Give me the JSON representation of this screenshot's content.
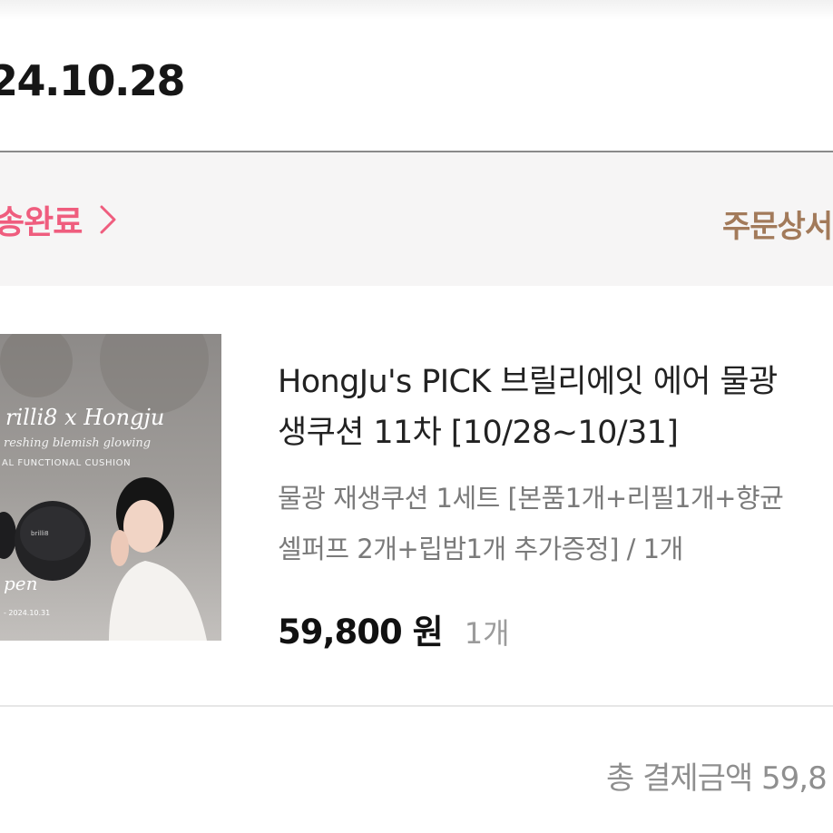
{
  "order": {
    "date": "24.10.28"
  },
  "status_bar": {
    "status_label": "송완료",
    "detail_link": "주문상서",
    "accent_color": "#ef5d7e",
    "detail_color": "#a27a5a"
  },
  "product": {
    "image_text": {
      "brand_line": "rilli8 x Hongju",
      "tagline": "reshing blemish glowing",
      "subtitle": "AL FUNCTIONAL CUSHION",
      "open_text": "pen",
      "date_range": "- 2024.10.31",
      "case_label": "brilli8"
    },
    "title_line1": "HongJu's PICK 브릴리에잇 에어 물광",
    "title_line2": "생쿠션 11차 [10/28~10/31]",
    "option_line1": "물광 재생쿠션 1세트 [본품1개+리필1개+향균",
    "option_line2": "셀퍼프 2개+립밤1개 추가증정] / 1개",
    "price": "59,800 원",
    "quantity": "1개"
  },
  "summary": {
    "total_label": "총 결제금액 59,8"
  }
}
